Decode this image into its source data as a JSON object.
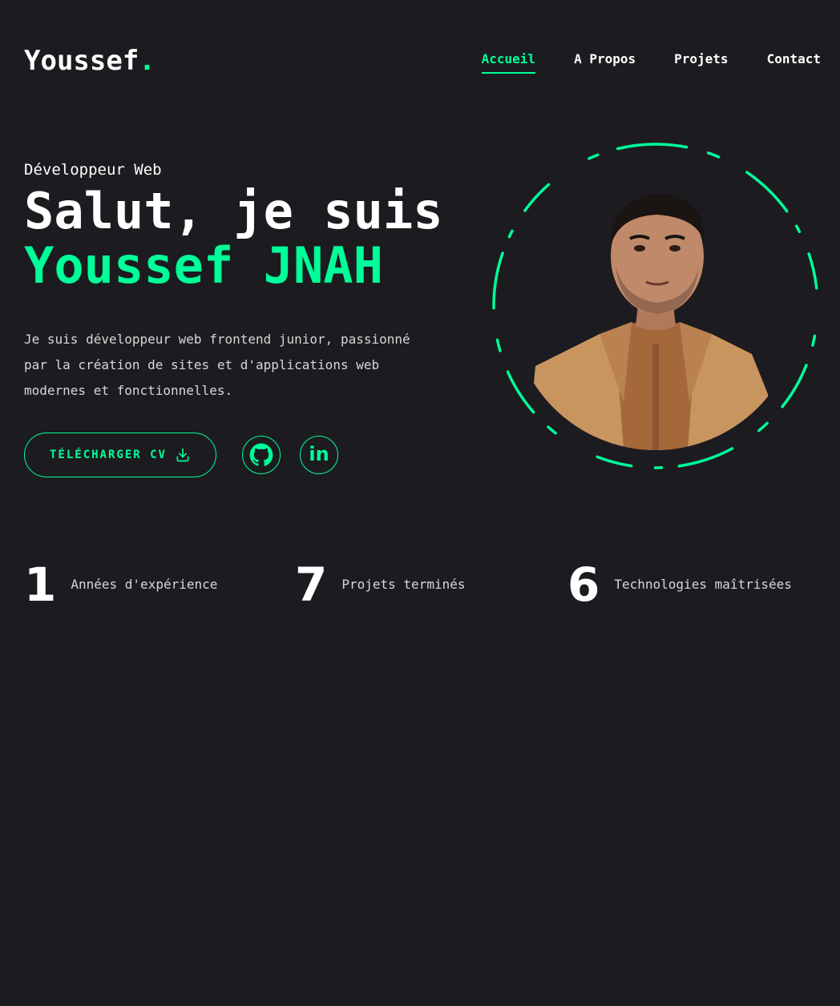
{
  "brand": {
    "name": "Youssef",
    "dot": "."
  },
  "nav": {
    "items": [
      {
        "label": "Accueil",
        "active": true
      },
      {
        "label": "A Propos",
        "active": false
      },
      {
        "label": "Projets",
        "active": false
      },
      {
        "label": "Contact",
        "active": false
      }
    ]
  },
  "hero": {
    "role": "Développeur Web",
    "greeting": "Salut, je suis",
    "name": "Youssef JNAH",
    "intro": "Je suis développeur web frontend junior, passionné par la création de sites et d'applications web modernes et fonctionnelles.",
    "cv_button_label": "TÉLÉCHARGER CV",
    "cv_icon": "download-icon",
    "socials": [
      {
        "name": "github-icon"
      },
      {
        "name": "linkedin-icon",
        "glyph": "in"
      }
    ]
  },
  "stats": [
    {
      "value": "1",
      "label": "Années d'expérience"
    },
    {
      "value": "7",
      "label": "Projets terminés"
    },
    {
      "value": "6",
      "label": "Technologies maîtrisées"
    }
  ],
  "colors": {
    "background": "#1c1c20",
    "accent": "#00ff99",
    "text": "#ffffff"
  }
}
